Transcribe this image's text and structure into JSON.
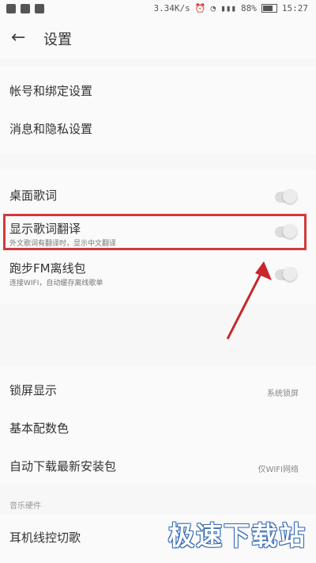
{
  "status_bar": {
    "network_speed": "3.34K/s",
    "time": "15:27",
    "battery_label": "88%"
  },
  "header": {
    "title": "设置"
  },
  "menu": {
    "account_binding": "帐号和绑定设置",
    "message_privacy": "消息和隐私设置",
    "desktop_lyrics": "桌面歌词",
    "show_translation": "显示歌词翻译",
    "show_translation_sub": "外文歌词有翻译时，显示中文翻译",
    "sync_fm": "跑步FM离线包",
    "sync_fm_sub": "连接WIFI，自动缓存离线歌单",
    "lock_screen": "锁屏显示",
    "lock_screen_value": "系统锁屏",
    "cover_colors": "基本配数色",
    "auto_download": "自动下载最新安装包",
    "auto_download_value": "仅WIFI网络",
    "music_hardware_caption": "音乐硬件",
    "headset_control": "耳机线控切歌"
  },
  "watermark": {
    "text": "极速下载站"
  },
  "colors": {
    "highlight": "#d33a3a",
    "arrow": "#c8262b"
  }
}
